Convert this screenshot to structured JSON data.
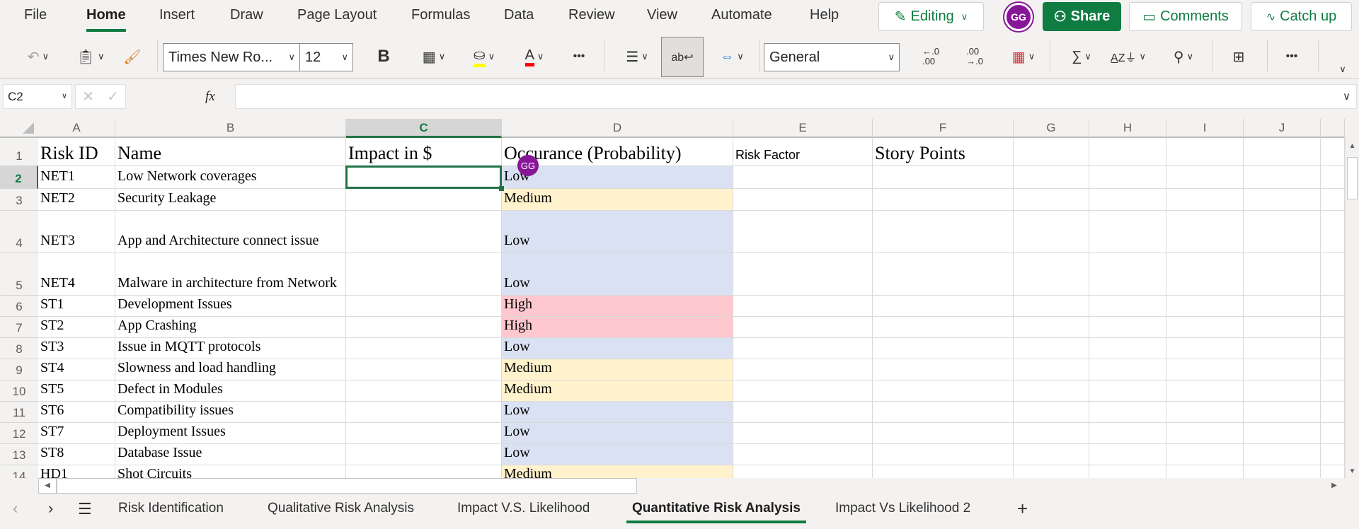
{
  "ribbon": {
    "tabs": [
      "File",
      "Home",
      "Insert",
      "Draw",
      "Page Layout",
      "Formulas",
      "Data",
      "Review",
      "View",
      "Automate",
      "Help"
    ],
    "active_tab": "Home",
    "editing_label": "Editing",
    "avatar_initials": "GG",
    "share_label": "Share",
    "comments_label": "Comments",
    "catchup_label": "Catch up",
    "font_name": "Times New Ro...",
    "font_size": "12",
    "bold_label": "B",
    "number_format": "General",
    "more_label": "•••"
  },
  "formula_bar": {
    "name_box": "C2",
    "fx_label": "fx",
    "value": ""
  },
  "columns": [
    "A",
    "B",
    "C",
    "D",
    "E",
    "F",
    "G",
    "H",
    "I",
    "J"
  ],
  "selected_column": "C",
  "selected_cell": "C2",
  "header_row": {
    "a": "Risk ID",
    "b": "Name",
    "c": "Impact in $",
    "d": "Occurance (Probability)",
    "e": "Risk Factor",
    "f": "Story Points"
  },
  "rows": [
    {
      "num": "2",
      "id": "NET1",
      "name": "Low Network coverages",
      "impact": "",
      "occurrence": "Low"
    },
    {
      "num": "3",
      "id": "NET2",
      "name": "Security Leakage",
      "impact": "",
      "occurrence": "Medium"
    },
    {
      "num": "4",
      "id": "NET3",
      "name": "App and Architecture connect issue",
      "impact": "",
      "occurrence": "Low"
    },
    {
      "num": "5",
      "id": "NET4",
      "name": "Malware in architecture from Network",
      "impact": "",
      "occurrence": "Low"
    },
    {
      "num": "6",
      "id": "ST1",
      "name": "Development Issues",
      "impact": "",
      "occurrence": "High"
    },
    {
      "num": "7",
      "id": "ST2",
      "name": "App Crashing",
      "impact": "",
      "occurrence": "High"
    },
    {
      "num": "8",
      "id": "ST3",
      "name": "Issue in MQTT protocols",
      "impact": "",
      "occurrence": "Low"
    },
    {
      "num": "9",
      "id": "ST4",
      "name": "Slowness and load handling",
      "impact": "",
      "occurrence": "Medium"
    },
    {
      "num": "10",
      "id": "ST5",
      "name": "Defect in Modules",
      "impact": "",
      "occurrence": "Medium"
    },
    {
      "num": "11",
      "id": "ST6",
      "name": "Compatibility issues",
      "impact": "",
      "occurrence": "Low"
    },
    {
      "num": "12",
      "id": "ST7",
      "name": "Deployment Issues",
      "impact": "",
      "occurrence": "Low"
    },
    {
      "num": "13",
      "id": "ST8",
      "name": "Database Issue",
      "impact": "",
      "occurrence": "Low"
    },
    {
      "num": "14",
      "id": "HD1",
      "name": "Shot Circuits",
      "impact": "",
      "occurrence": "Medium"
    }
  ],
  "level_colors": {
    "Low": "#d9e1f2",
    "Medium": "#fff2cc",
    "High": "#ffc7ce"
  },
  "accent_color": "#107c41",
  "collaborator_color": "#881798",
  "sheet_tabs": [
    "Risk Identification",
    "Qualitative Risk Analysis",
    "Impact V.S. Likelihood",
    "Quantitative Risk Analysis",
    "Impact Vs Likelihood 2"
  ],
  "active_sheet": "Quantitative Risk Analysis",
  "add_sheet_label": "+"
}
